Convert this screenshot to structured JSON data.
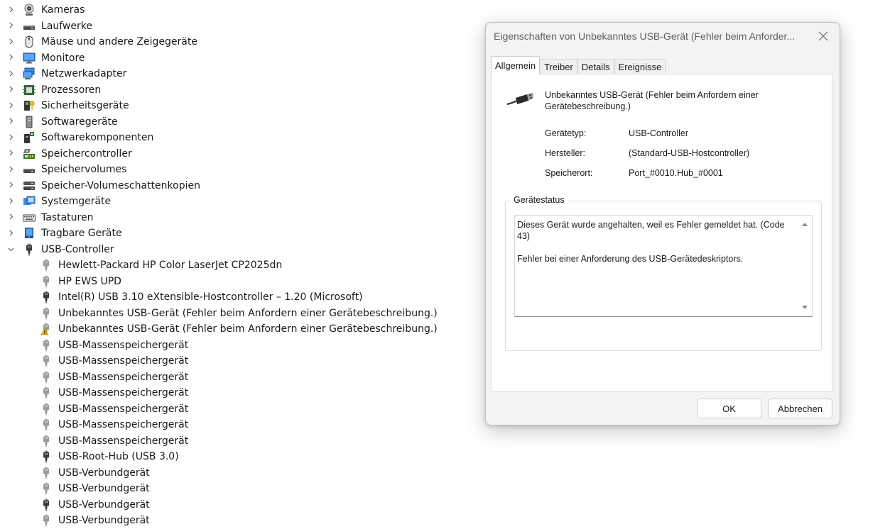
{
  "tree": {
    "categories": [
      {
        "label": "Kameras",
        "icon": "camera-icon"
      },
      {
        "label": "Laufwerke",
        "icon": "drive-icon"
      },
      {
        "label": "Mäuse und andere Zeigegeräte",
        "icon": "mouse-icon"
      },
      {
        "label": "Monitore",
        "icon": "monitor-icon"
      },
      {
        "label": "Netzwerkadapter",
        "icon": "network-adapter-icon"
      },
      {
        "label": "Prozessoren",
        "icon": "processor-icon"
      },
      {
        "label": "Sicherheitsgeräte",
        "icon": "security-device-icon"
      },
      {
        "label": "Softwaregeräte",
        "icon": "software-device-icon"
      },
      {
        "label": "Softwarekomponenten",
        "icon": "software-component-icon"
      },
      {
        "label": "Speichercontroller",
        "icon": "storage-controller-icon"
      },
      {
        "label": "Speichervolumes",
        "icon": "drive-icon"
      },
      {
        "label": "Speicher-Volumeschattenkopien",
        "icon": "shadow-copy-icon"
      },
      {
        "label": "Systemgeräte",
        "icon": "system-device-icon"
      },
      {
        "label": "Tastaturen",
        "icon": "keyboard-icon"
      },
      {
        "label": "Tragbare Geräte",
        "icon": "portable-device-icon"
      }
    ],
    "usb_category": {
      "label": "USB-Controller",
      "icon": "usb-icon"
    },
    "usb_devices": [
      {
        "label": "Hewlett-Packard HP Color LaserJet CP2025dn",
        "icon": "usb-plug-icon"
      },
      {
        "label": "HP EWS UPD",
        "icon": "usb-plug-icon"
      },
      {
        "label": "Intel(R) USB 3.10 eXtensible-Hostcontroller – 1.20 (Microsoft)",
        "icon": "usb-plug-dark-icon"
      },
      {
        "label": "Unbekanntes USB-Gerät (Fehler beim Anfordern einer Gerätebeschreibung.)",
        "icon": "usb-plug-icon"
      },
      {
        "label": "Unbekanntes USB-Gerät (Fehler beim Anfordern einer Gerätebeschreibung.)",
        "icon": "usb-warning-icon"
      },
      {
        "label": "USB-Massenspeichergerät",
        "icon": "usb-plug-icon"
      },
      {
        "label": "USB-Massenspeichergerät",
        "icon": "usb-plug-icon"
      },
      {
        "label": "USB-Massenspeichergerät",
        "icon": "usb-plug-icon"
      },
      {
        "label": "USB-Massenspeichergerät",
        "icon": "usb-plug-icon"
      },
      {
        "label": "USB-Massenspeichergerät",
        "icon": "usb-plug-icon"
      },
      {
        "label": "USB-Massenspeichergerät",
        "icon": "usb-plug-icon"
      },
      {
        "label": "USB-Massenspeichergerät",
        "icon": "usb-plug-icon"
      },
      {
        "label": "USB-Root-Hub (USB 3.0)",
        "icon": "usb-plug-dark-icon"
      },
      {
        "label": "USB-Verbundgerät",
        "icon": "usb-plug-icon"
      },
      {
        "label": "USB-Verbundgerät",
        "icon": "usb-plug-icon"
      },
      {
        "label": "USB-Verbundgerät",
        "icon": "usb-plug-dark-icon"
      },
      {
        "label": "USB-Verbundgerät",
        "icon": "usb-plug-icon"
      }
    ]
  },
  "dialog": {
    "title": "Eigenschaften von Unbekanntes USB-Gerät (Fehler beim Anforder...",
    "close_icon": "close-icon",
    "tabs": [
      {
        "label": "Allgemein",
        "active": true
      },
      {
        "label": "Treiber",
        "active": false
      },
      {
        "label": "Details",
        "active": false
      },
      {
        "label": "Ereignisse",
        "active": false
      }
    ],
    "device_name": "Unbekanntes USB-Gerät (Fehler beim Anfordern einer Gerätebeschreibung.)",
    "properties": [
      {
        "key": "Gerätetyp:",
        "value": "USB-Controller"
      },
      {
        "key": "Hersteller:",
        "value": "(Standard-USB-Hostcontroller)"
      },
      {
        "key": "Speicherort:",
        "value": "Port_#0010.Hub_#0001"
      }
    ],
    "status_legend": "Gerätestatus",
    "status_text": "Dieses Gerät wurde angehalten, weil es Fehler gemeldet hat. (Code 43)\n\nFehler bei einer Anforderung des USB-Gerätedeskriptors.",
    "ok_label": "OK",
    "cancel_label": "Abbrechen"
  }
}
